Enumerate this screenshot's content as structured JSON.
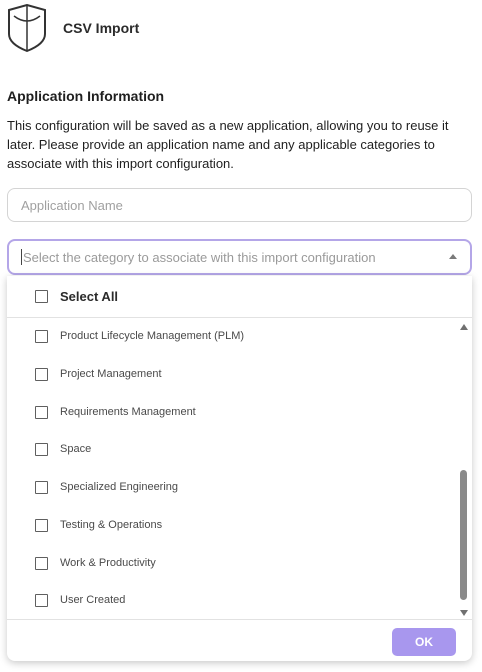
{
  "header": {
    "app_title": "CSV Import",
    "logo_icon": "shield-outline-logo"
  },
  "application_info": {
    "title": "Application Information",
    "description": "This configuration will be saved as a new application, allowing you to reuse it later. Please provide an application name and any applicable categories to associate with this import configuration."
  },
  "name_field": {
    "placeholder": "Application Name",
    "value": ""
  },
  "category_field": {
    "placeholder": "Select the category to associate with this import configuration",
    "arrow_icon": "chevron-up-icon"
  },
  "dropdown": {
    "select_all_label": "Select All",
    "options": [
      {
        "label": "Product Lifecycle Management (PLM)",
        "checked": false
      },
      {
        "label": "Project Management",
        "checked": false
      },
      {
        "label": "Requirements Management",
        "checked": false
      },
      {
        "label": "Space",
        "checked": false
      },
      {
        "label": "Specialized Engineering",
        "checked": false
      },
      {
        "label": "Testing & Operations",
        "checked": false
      },
      {
        "label": "Work & Productivity",
        "checked": false
      },
      {
        "label": "User Created",
        "checked": false
      }
    ],
    "ok_label": "OK"
  },
  "colors": {
    "accent": "#a897ee",
    "focus_border": "#b4a6e8",
    "text": "#1f1f1f",
    "muted": "#9a9a9a"
  }
}
